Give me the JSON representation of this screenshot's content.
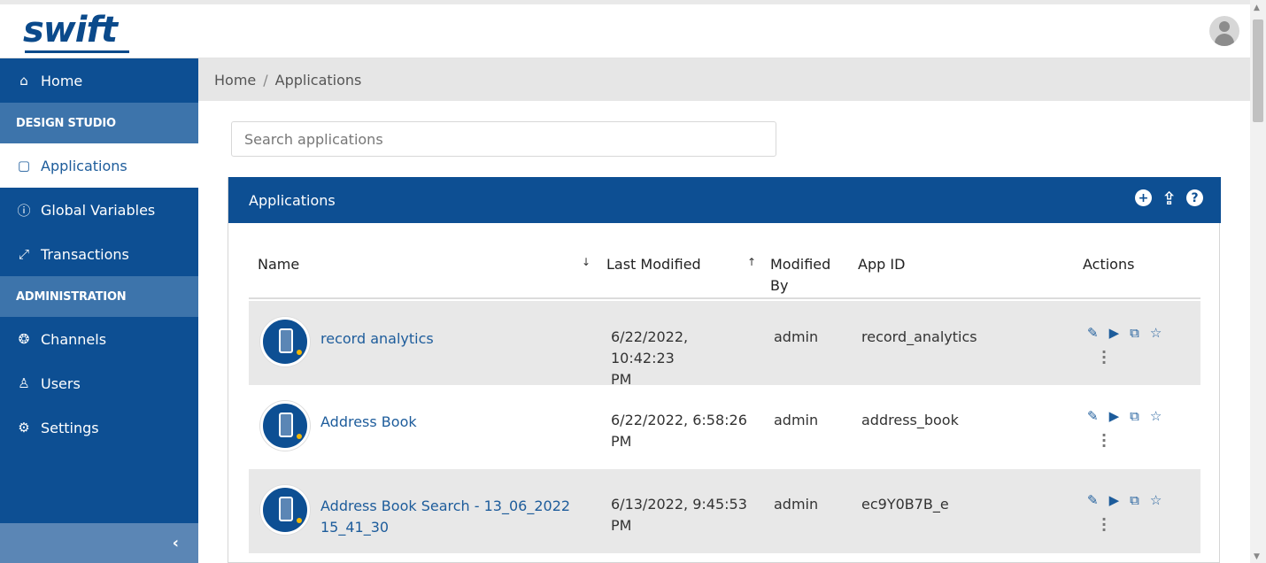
{
  "header": {
    "logo": "swift",
    "avatar_icon": "user-avatar-icon"
  },
  "sidebar": {
    "home": {
      "icon": "home-icon",
      "label": "Home"
    },
    "section_design": "DESIGN STUDIO",
    "items_design": [
      {
        "icon": "calendar-icon",
        "label": "Applications"
      },
      {
        "icon": "info-icon",
        "label": "Global Variables"
      },
      {
        "icon": "expand-icon",
        "label": "Transactions"
      }
    ],
    "section_admin": "ADMINISTRATION",
    "items_admin": [
      {
        "icon": "channels-icon",
        "label": "Channels"
      },
      {
        "icon": "user-icon",
        "label": "Users"
      },
      {
        "icon": "gear-icon",
        "label": "Settings"
      }
    ],
    "collapse_icon": "chevron-left-icon"
  },
  "breadcrumb": {
    "home": "Home",
    "separator": "/",
    "current": "Applications"
  },
  "search": {
    "placeholder": "Search applications",
    "value": ""
  },
  "panel": {
    "title": "Applications",
    "tools": [
      "add-icon",
      "upload-icon",
      "help-icon"
    ]
  },
  "table": {
    "headers": {
      "name": "Name",
      "last_modified": "Last Modified",
      "modified_by_1": "Modified",
      "modified_by_2": "By",
      "app_id": "App ID",
      "actions": "Actions"
    },
    "rows": [
      {
        "name": "record analytics",
        "name2": "",
        "modified": "6/22/2022, 10:42:23",
        "modified2": "PM",
        "by": "admin",
        "app_id": "record_analytics"
      },
      {
        "name": "Address Book",
        "name2": "",
        "modified": "6/22/2022, 6:58:26",
        "modified2": "PM",
        "by": "admin",
        "app_id": "address_book"
      },
      {
        "name": "Address Book Search - 13_06_2022",
        "name2": "15_41_30",
        "modified": "6/13/2022, 9:45:53",
        "modified2": "PM",
        "by": "admin",
        "app_id": "ec9Y0B7B_e"
      }
    ]
  },
  "colors": {
    "brand": "#0d4f93",
    "section": "#3d74ab",
    "link": "#1d5c9b",
    "row_alt": "#e8e8e8"
  }
}
